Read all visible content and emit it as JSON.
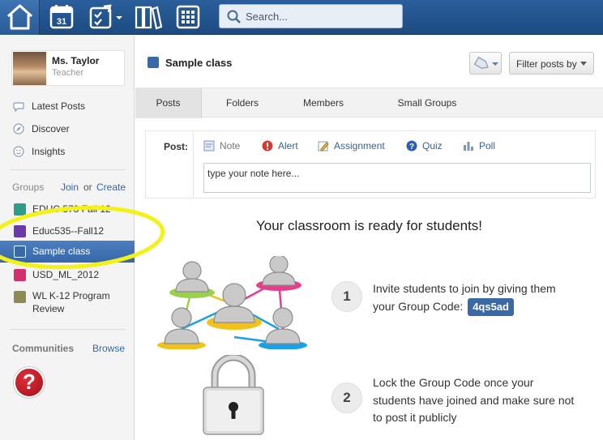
{
  "search": {
    "placeholder": "Search..."
  },
  "profile": {
    "name": "Ms. Taylor",
    "role": "Teacher"
  },
  "nav": [
    {
      "label": "Latest Posts",
      "icon": "speech-bubble-icon"
    },
    {
      "label": "Discover",
      "icon": "compass-icon"
    },
    {
      "label": "Insights",
      "icon": "smiley-icon"
    }
  ],
  "groups_section": {
    "heading": "Groups",
    "join": "Join",
    "or": "or",
    "create": "Create"
  },
  "groups": [
    {
      "label": "EDUC 578 Fall 12",
      "color": "#2e9e8a"
    },
    {
      "label": "Educ535--Fall12",
      "color": "#6a3aa8"
    },
    {
      "label": "Sample class",
      "color": "#3a69a6"
    },
    {
      "label": "USD_ML_2012",
      "color": "#d4306e"
    },
    {
      "label": "WL K-12 Program Review",
      "color": "#8d8a52"
    }
  ],
  "communities": {
    "heading": "Communities",
    "browse": "Browse"
  },
  "main": {
    "class_title": "Sample class",
    "filter_label": "Filter posts by",
    "tabs": [
      "Posts",
      "Folders",
      "Members",
      "Small Groups"
    ],
    "post_label": "Post:",
    "post_types": [
      "Note",
      "Alert",
      "Assignment",
      "Quiz",
      "Poll"
    ],
    "note_placeholder": "type your note here...",
    "ready_heading": "Your classroom is ready for students!",
    "step1": {
      "num": "1",
      "line1": "Invite students to join by giving them",
      "line2": "your Group Code:",
      "code": "4qs5ad"
    },
    "step2": {
      "num": "2",
      "line1": "Lock the Group Code once your",
      "line2": "students have joined and make sure not",
      "line3": "to post it publicly"
    }
  }
}
